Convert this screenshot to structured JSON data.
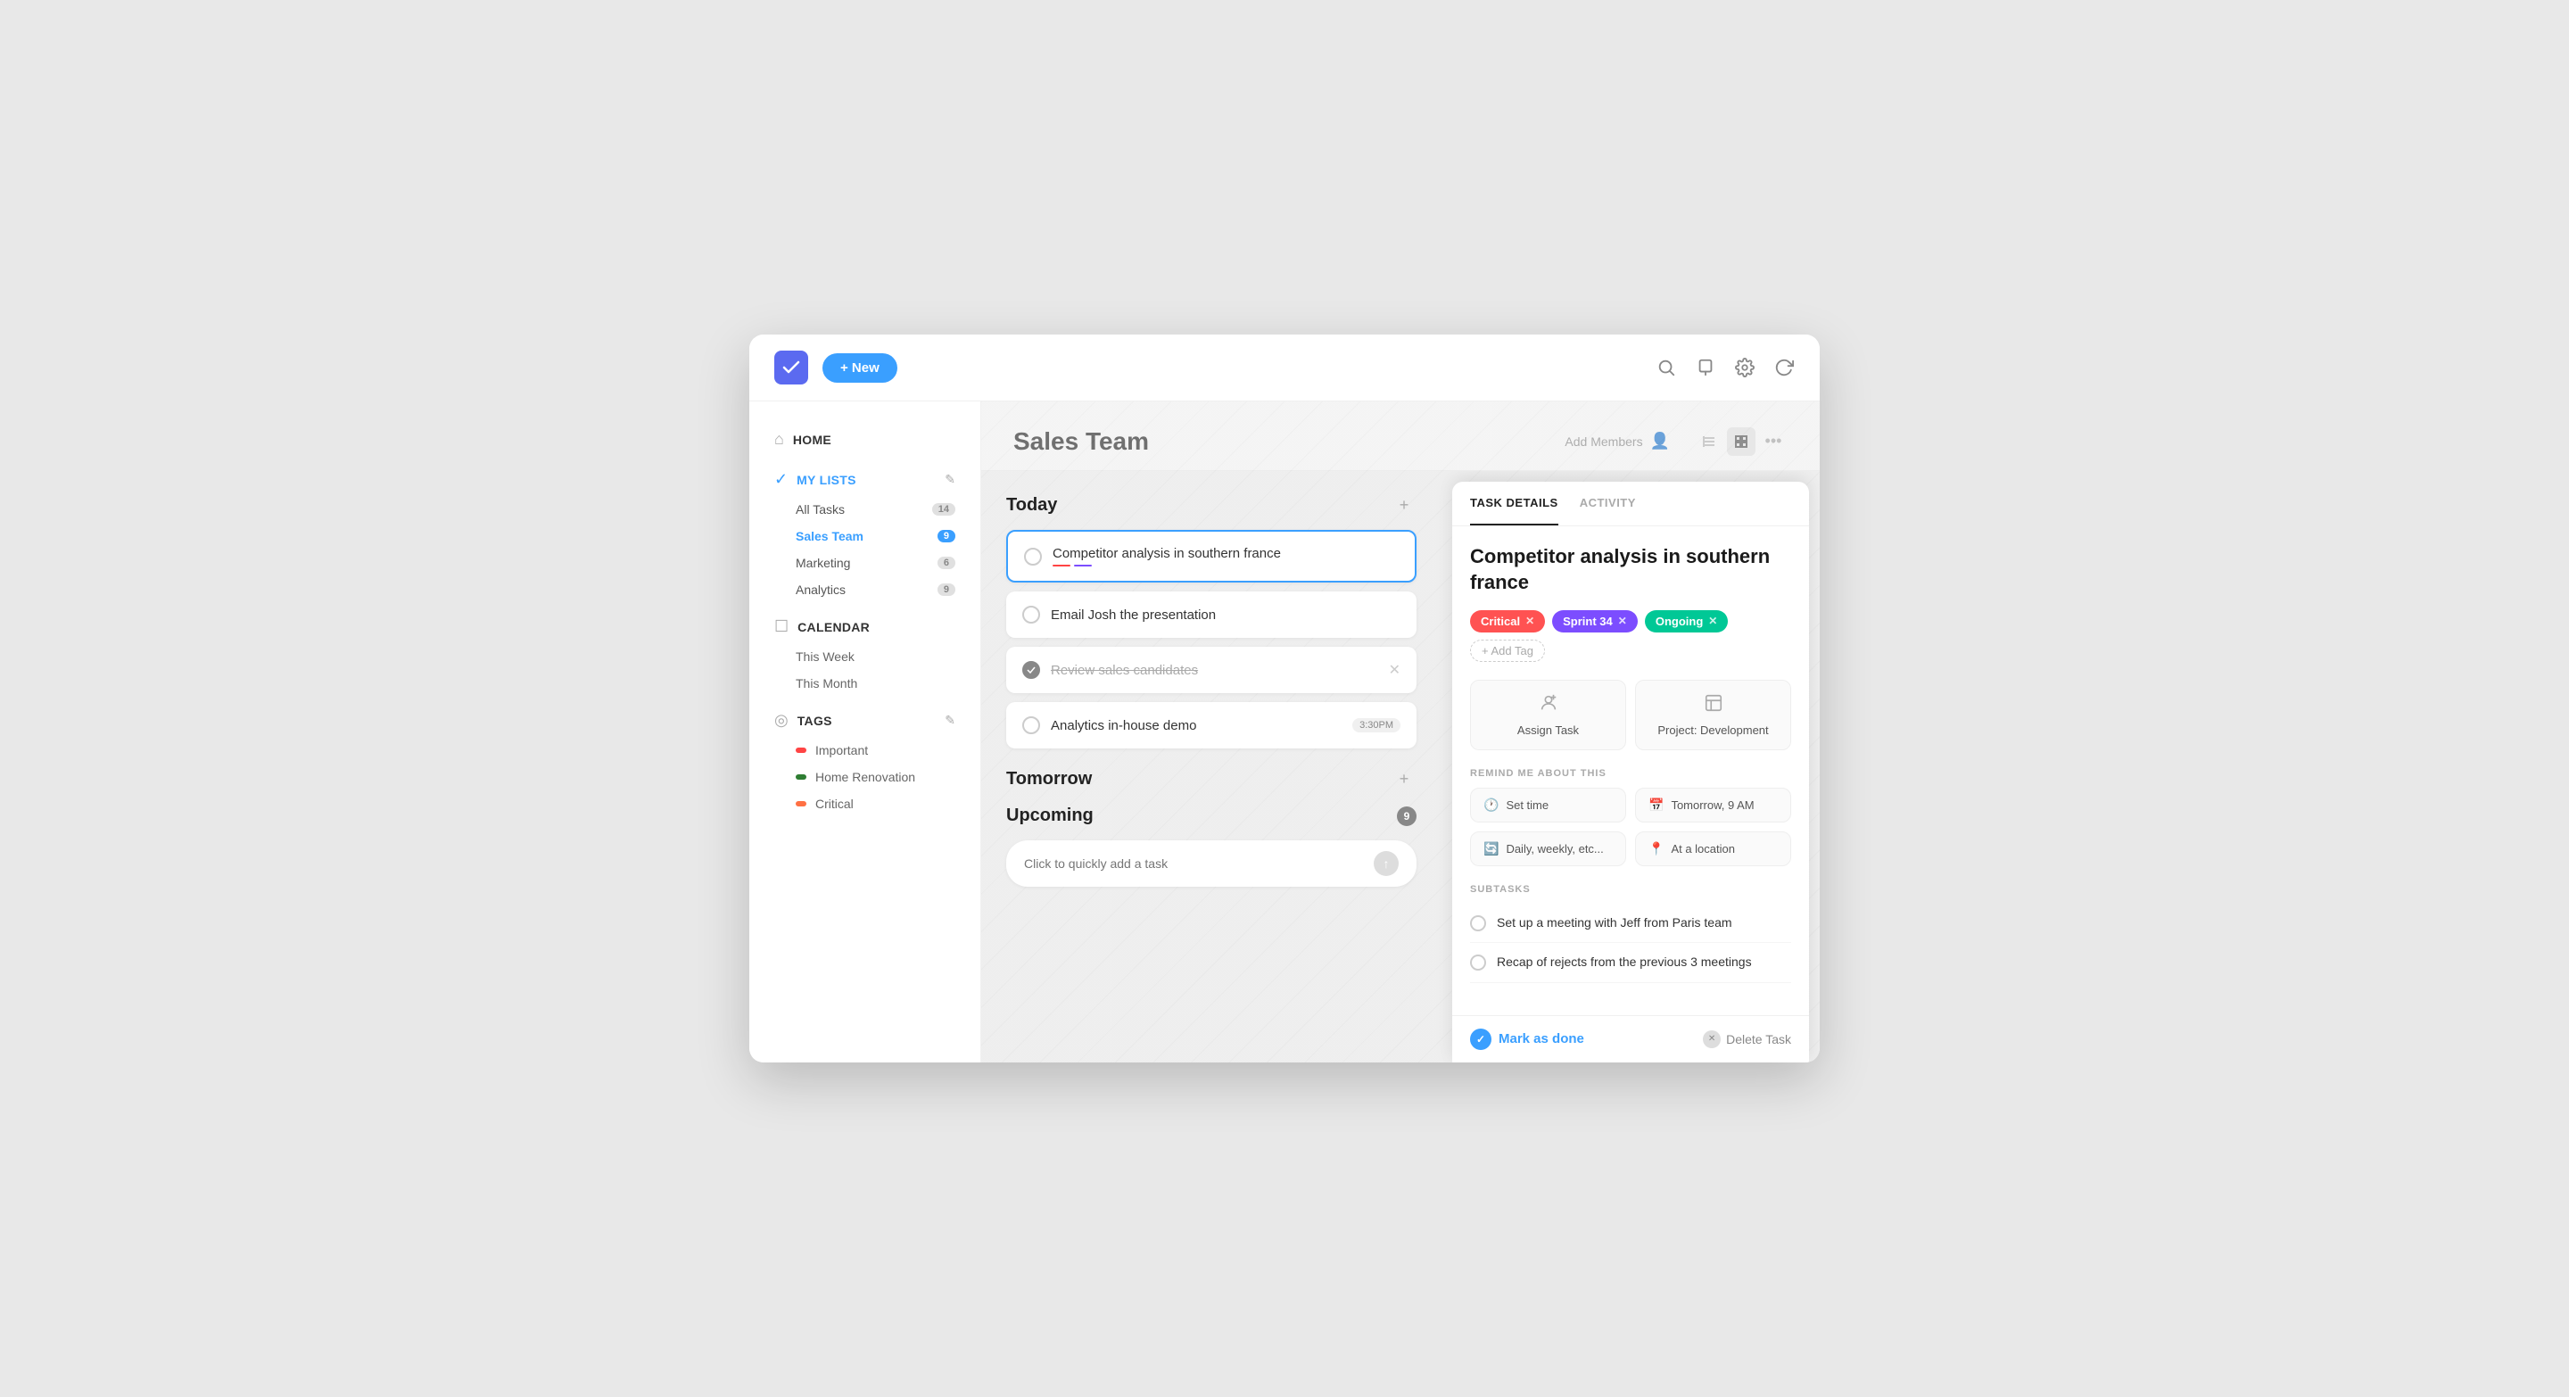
{
  "topbar": {
    "new_label": "+ New",
    "search_tooltip": "Search",
    "notifications_tooltip": "Notifications",
    "settings_tooltip": "Settings",
    "refresh_tooltip": "Refresh"
  },
  "sidebar": {
    "home_label": "HOME",
    "my_lists_label": "MY LISTS",
    "all_tasks_label": "All Tasks",
    "all_tasks_count": "14",
    "sales_team_label": "Sales Team",
    "sales_team_count": "9",
    "marketing_label": "Marketing",
    "marketing_count": "6",
    "analytics_label": "Analytics",
    "analytics_count": "9",
    "calendar_label": "CALENDAR",
    "this_week_label": "This Week",
    "this_month_label": "This Month",
    "tags_label": "TAGS",
    "tag_important": "Important",
    "tag_home_renovation": "Home Renovation",
    "tag_critical": "Critical"
  },
  "main": {
    "title": "Sales Team",
    "add_members_label": "Add Members",
    "today_label": "Today",
    "tomorrow_label": "Tomorrow",
    "upcoming_label": "Upcoming",
    "upcoming_count": "9",
    "task1_text": "Competitor analysis in southern france",
    "task2_text": "Email Josh the presentation",
    "task3_text": "Review sales candidates",
    "task4_text": "Analytics in-house demo",
    "task4_time": "3:30PM",
    "quick_add_placeholder": "Click to quickly add a task"
  },
  "detail": {
    "tab_details": "TASK DETAILS",
    "tab_activity": "ACTIVITY",
    "task_title": "Competitor analysis in southern france",
    "tag_critical": "Critical",
    "tag_sprint": "Sprint 34",
    "tag_ongoing": "Ongoing",
    "add_tag_label": "+ Add Tag",
    "assign_task_label": "Assign Task",
    "project_label": "Project: Development",
    "remind_section": "REMIND ME ABOUT THIS",
    "remind_set_time": "Set time",
    "remind_tomorrow": "Tomorrow, 9 AM",
    "remind_daily": "Daily, weekly, etc...",
    "remind_location": "At a location",
    "subtasks_section": "SUBTASKS",
    "subtask1": "Set up a meeting with Jeff from Paris team",
    "subtask2": "Recap of rejects from the previous 3 meetings",
    "mark_done_label": "Mark as done",
    "delete_task_label": "Delete Task"
  }
}
